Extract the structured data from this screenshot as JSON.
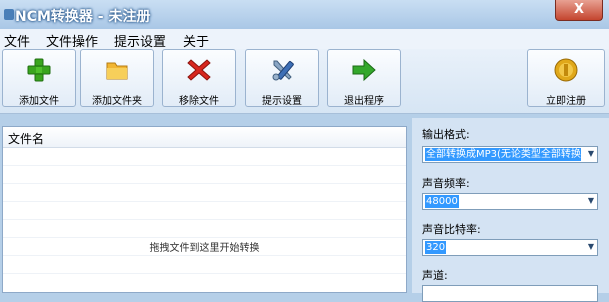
{
  "window": {
    "title": "NCM转换器 - 未注册",
    "close_glyph": "X"
  },
  "menu": [
    "文件",
    "文件操作",
    "提示设置",
    "关于"
  ],
  "toolbar": {
    "add_file": "添加文件",
    "add_folder": "添加文件夹",
    "remove_file": "移除文件",
    "prompt_settings": "提示设置",
    "exit": "退出程序",
    "register": "立即注册"
  },
  "file_list": {
    "column_header": "文件名",
    "drop_hint": "拖拽文件到这里开始转换"
  },
  "settings": {
    "output_format": {
      "label": "输出格式:",
      "value": "全部转换成MP3(无论类型全部转换"
    },
    "sample_rate": {
      "label": "声音频率:",
      "value": "48000"
    },
    "bitrate": {
      "label": "声音比特率:",
      "value": "320"
    },
    "channels": {
      "label": "声道:"
    }
  },
  "colors": {
    "title_text": "#ffffff",
    "selection": "#3399ff",
    "add_icon": "#3aa51e",
    "remove_icon": "#d7261e",
    "exit_icon": "#34a82c",
    "register_icon": "#e0a81a"
  },
  "icons": {
    "add_file": "plus-icon",
    "add_folder": "folder-icon",
    "remove_file": "x-icon",
    "prompt_settings": "tools-icon",
    "exit": "arrow-right-icon",
    "register": "coin-icon"
  }
}
